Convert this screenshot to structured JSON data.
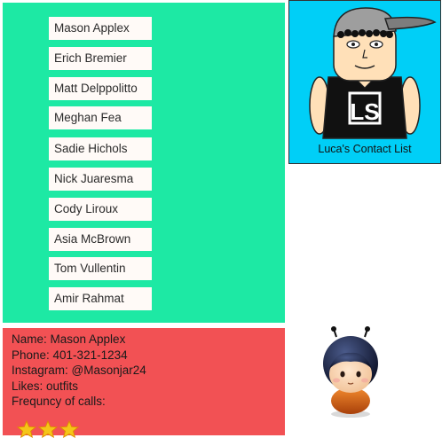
{
  "contacts": [
    {
      "name": "Mason Applex"
    },
    {
      "name": "Erich Bremier"
    },
    {
      "name": "Matt Delppolitto"
    },
    {
      "name": "Meghan Fea"
    },
    {
      "name": "Sadie Hichols"
    },
    {
      "name": "Nick Juaresma"
    },
    {
      "name": "Cody Liroux"
    },
    {
      "name": "Asia McBrown"
    },
    {
      "name": "Tom Vullentin"
    },
    {
      "name": "Amir Rahmat"
    }
  ],
  "logo": {
    "caption": "Luca's Contact List",
    "shirt_text": "LS"
  },
  "details": {
    "name": "Name: Mason Applex",
    "phone": "Phone: 401-321-1234",
    "instagram": "Instagram: @Masonjar24",
    "likes": "Likes: outfits",
    "frequency": "Frequncy of calls:",
    "frequency_stars": 3
  },
  "colors": {
    "list_bg": "#1de9a4",
    "logo_bg": "#00cff7",
    "details_bg": "#f25154",
    "star": "#f5c518"
  },
  "icons": [
    "avatar-illustration",
    "star-icon",
    "mascot-doll-icon"
  ]
}
